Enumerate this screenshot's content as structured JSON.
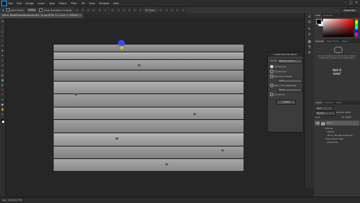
{
  "menubar": {
    "items": [
      "File",
      "Edit",
      "Image",
      "Layer",
      "Type",
      "Select",
      "Filter",
      "3D",
      "View",
      "Window",
      "Help"
    ]
  },
  "options": {
    "auto_select": "Auto-Select:",
    "target": "Group",
    "show_transform": "Show Transform Controls",
    "mode_3d": "3D Mode:",
    "workspace": "Essentials"
  },
  "document": {
    "tab_title": "iStock_WoodPlanksBackground01_1k.jpg @ 66.7% (Layer 0, RGB/8*) ×",
    "status": "Doc: 3.00M/4.70M"
  },
  "dialog_3d": {
    "title": "Create New 3D Object",
    "source_label": "Source:",
    "source_value": "Selected Layer(s)",
    "options": [
      "3D Postcard",
      "3D Extrusion",
      "Mesh From Preset",
      "Mesh From Depth Map",
      "3D Volume"
    ],
    "selected_option": 0,
    "preset_value": "Cube",
    "depth_value": "Plane",
    "create_label": "Create"
  },
  "color_panel": {
    "tabs": [
      "Color",
      "Swatches"
    ],
    "fg": "#000000",
    "bg": "#ffffff"
  },
  "libraries_panel": {
    "tabs": [
      "Libraries",
      "Adjustments",
      "Styles"
    ],
    "message": "To use Creative Cloud Libraries, please install the Creative Cloud Application.",
    "cta": "Get it now!"
  },
  "layers_panel": {
    "tabs": [
      "Layers",
      "Channels",
      "Paths"
    ],
    "filter_kind": "Kind",
    "blend_mode": "Normal",
    "opacity_label": "Opacity:",
    "opacity_value": "100%",
    "lock_label": "Lock:",
    "fill_label": "Fill:",
    "fill_value": "100%",
    "layer_name": "Layer 0",
    "sub_items": [
      "Textures",
      "Diffuse",
      "iStock_WoodPlanksBackgr...",
      "Image Based Light",
      "Default IBL"
    ]
  }
}
